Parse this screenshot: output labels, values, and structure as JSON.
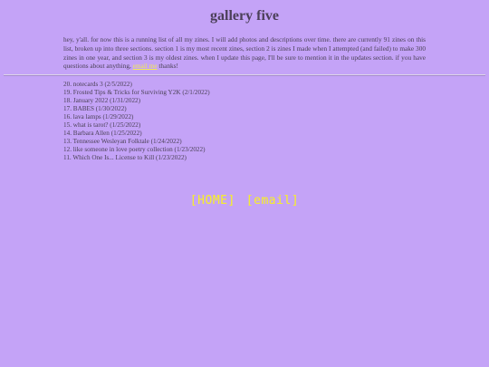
{
  "page": {
    "title": "gallery five"
  },
  "intro": {
    "before_link": "hey, y'all. for now this is a running list of all my zines. I will add photos and descriptions over time. there are currently 91 zines on this list, broken up into three sections. section 1 is my most recent zines, section 2 is zines I made when I attempted (and failed) to make 300 zines in one year, and section 3 is my oldest zines. when I update this page, I'll be sure to mention it in the updates section. if you have questions about anything, ",
    "link_text": "email me",
    "after_link": " thanks!"
  },
  "zines": [
    "20. notecards 3 (2/5/2022)",
    "19. Frosted Tips & Tricks for Surviving Y2K (2/1/2022)",
    "18. January 2022 (1/31/2022)",
    "17. BABES (1/30/2022)",
    "16. lava lamps (1/29/2022)",
    "15. what is tarot? (1/25/2022)",
    "14. Barbara Allen (1/25/2022)",
    "13. Tennessee Wesleyan Folktale (1/24/2022)",
    "12. like someone in love poetry collection (1/23/2022)",
    "11. Which One Is... License to Kill (1/23/2022)"
  ],
  "nav": {
    "home_label": "[HOME]",
    "email_label": "[email]"
  },
  "colors": {
    "background": "#c4a3f7",
    "text": "#4a4156",
    "link": "#f4ea36"
  }
}
